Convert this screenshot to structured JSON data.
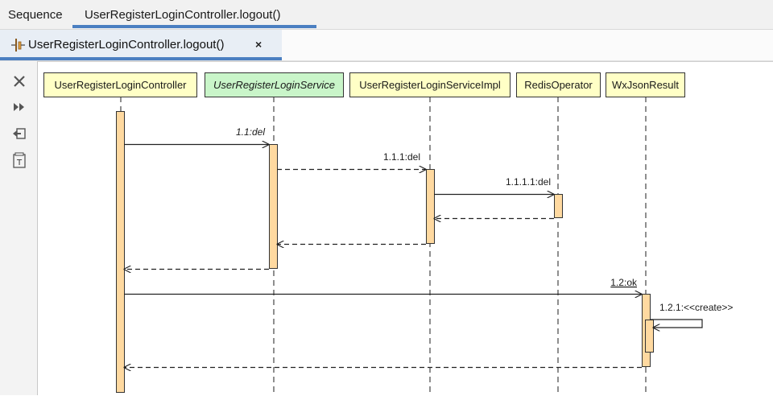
{
  "window": {
    "tabs": [
      {
        "label": "Sequence",
        "active": false
      },
      {
        "label": "UserRegisterLoginController.logout()",
        "active": true
      }
    ]
  },
  "editor": {
    "tab_label": "UserRegisterLoginController.logout()",
    "tab_icon": "sequence-diagram-icon",
    "close_label": "×",
    "close_icon": "close-icon"
  },
  "toolbar": {
    "items": [
      {
        "name": "close-icon",
        "glyph": "✕"
      },
      {
        "name": "fast-forward-icon",
        "glyph": "▸▸"
      },
      {
        "name": "restore-icon",
        "glyph": "⇦"
      },
      {
        "name": "text-icon",
        "glyph": "T"
      }
    ]
  },
  "diagram": {
    "colors": {
      "participant_fill": "#ffffc6",
      "interface_fill": "#c9f5c9",
      "activation_fill": "#ffd9a0",
      "border": "#333333"
    },
    "participants": [
      {
        "label": "UserRegisterLoginController",
        "italic": false
      },
      {
        "label": "UserRegisterLoginService",
        "italic": true
      },
      {
        "label": "UserRegisterLoginServiceImpl",
        "italic": false
      },
      {
        "label": "RedisOperator",
        "italic": false
      },
      {
        "label": "WxJsonResult",
        "italic": false
      }
    ],
    "messages": [
      {
        "label": "1.1:del",
        "from": 0,
        "to": 1,
        "kind": "call",
        "italic": true
      },
      {
        "label": "1.1.1:del",
        "from": 1,
        "to": 2,
        "kind": "async"
      },
      {
        "label": "1.1.1.1:del",
        "from": 2,
        "to": 3,
        "kind": "call"
      },
      {
        "label": "",
        "from": 3,
        "to": 2,
        "kind": "return"
      },
      {
        "label": "",
        "from": 2,
        "to": 1,
        "kind": "return"
      },
      {
        "label": "",
        "from": 1,
        "to": 0,
        "kind": "return"
      },
      {
        "label": "1.2:ok",
        "from": 0,
        "to": 4,
        "kind": "call",
        "underline": true
      },
      {
        "label": "1.2.1:<<create>>",
        "from": 4,
        "to": 4,
        "kind": "self"
      },
      {
        "label": "",
        "from": 4,
        "to": 0,
        "kind": "return"
      }
    ]
  }
}
